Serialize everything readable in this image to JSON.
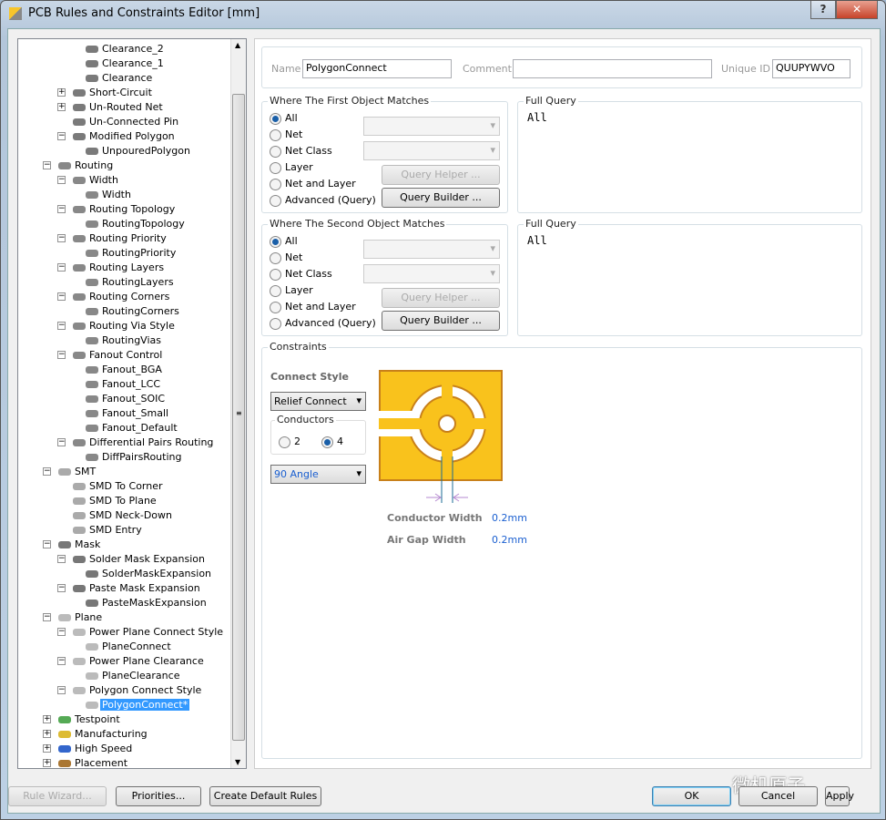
{
  "window": {
    "title": "PCB Rules and Constraints Editor [mm]",
    "help": "?",
    "close": "✕"
  },
  "tree": [
    [
      "Clearance_2",
      3,
      "",
      "rule"
    ],
    [
      "Clearance_1",
      3,
      "",
      "rule"
    ],
    [
      "Clearance",
      3,
      "",
      "rule"
    ],
    [
      "Short-Circuit",
      2,
      "+",
      "rule"
    ],
    [
      "Un-Routed Net",
      2,
      "+",
      "rule"
    ],
    [
      "Un-Connected Pin",
      2,
      "",
      "rule"
    ],
    [
      "Modified Polygon",
      2,
      "-",
      "rule"
    ],
    [
      "UnpouredPolygon",
      3,
      "",
      "rule"
    ],
    [
      "Routing",
      1,
      "-",
      "route"
    ],
    [
      "Width",
      2,
      "-",
      "route"
    ],
    [
      "Width",
      3,
      "",
      "route"
    ],
    [
      "Routing Topology",
      2,
      "-",
      "route"
    ],
    [
      "RoutingTopology",
      3,
      "",
      "route"
    ],
    [
      "Routing Priority",
      2,
      "-",
      "route"
    ],
    [
      "RoutingPriority",
      3,
      "",
      "route"
    ],
    [
      "Routing Layers",
      2,
      "-",
      "route"
    ],
    [
      "RoutingLayers",
      3,
      "",
      "route"
    ],
    [
      "Routing Corners",
      2,
      "-",
      "route"
    ],
    [
      "RoutingCorners",
      3,
      "",
      "route"
    ],
    [
      "Routing Via Style",
      2,
      "-",
      "route"
    ],
    [
      "RoutingVias",
      3,
      "",
      "route"
    ],
    [
      "Fanout Control",
      2,
      "-",
      "route"
    ],
    [
      "Fanout_BGA",
      3,
      "",
      "route"
    ],
    [
      "Fanout_LCC",
      3,
      "",
      "route"
    ],
    [
      "Fanout_SOIC",
      3,
      "",
      "route"
    ],
    [
      "Fanout_Small",
      3,
      "",
      "route"
    ],
    [
      "Fanout_Default",
      3,
      "",
      "route"
    ],
    [
      "Differential Pairs Routing",
      2,
      "-",
      "route"
    ],
    [
      "DiffPairsRouting",
      3,
      "",
      "route"
    ],
    [
      "SMT",
      1,
      "-",
      "smt"
    ],
    [
      "SMD To Corner",
      2,
      "",
      "smt"
    ],
    [
      "SMD To Plane",
      2,
      "",
      "smt"
    ],
    [
      "SMD Neck-Down",
      2,
      "",
      "smt"
    ],
    [
      "SMD Entry",
      2,
      "",
      "smt"
    ],
    [
      "Mask",
      1,
      "-",
      "mask"
    ],
    [
      "Solder Mask Expansion",
      2,
      "-",
      "mask"
    ],
    [
      "SolderMaskExpansion",
      3,
      "",
      "mask"
    ],
    [
      "Paste Mask Expansion",
      2,
      "-",
      "mask"
    ],
    [
      "PasteMaskExpansion",
      3,
      "",
      "mask"
    ],
    [
      "Plane",
      1,
      "-",
      "plane"
    ],
    [
      "Power Plane Connect Style",
      2,
      "-",
      "plane"
    ],
    [
      "PlaneConnect",
      3,
      "",
      "plane"
    ],
    [
      "Power Plane Clearance",
      2,
      "-",
      "plane"
    ],
    [
      "PlaneClearance",
      3,
      "",
      "plane"
    ],
    [
      "Polygon Connect Style",
      2,
      "-",
      "plane"
    ],
    [
      "PolygonConnect*",
      3,
      "",
      "plane"
    ],
    [
      "Testpoint",
      1,
      "+",
      "test"
    ],
    [
      "Manufacturing",
      1,
      "+",
      "mfg"
    ],
    [
      "High Speed",
      1,
      "+",
      "hs"
    ],
    [
      "Placement",
      1,
      "+",
      "place"
    ]
  ],
  "selected_index": 45,
  "rule": {
    "name_label": "Name",
    "name": "PolygonConnect",
    "comment_label": "Comment",
    "comment": "",
    "uid_label": "Unique ID",
    "uid": "QUUPYWVO"
  },
  "first": {
    "title": "Where The First Object Matches",
    "options": [
      "All",
      "Net",
      "Net Class",
      "Layer",
      "Net and Layer",
      "Advanced (Query)"
    ],
    "selected": "All",
    "query_helper": "Query Helper ...",
    "query_builder": "Query Builder ...",
    "full_query_label": "Full Query",
    "full_query": "All"
  },
  "second": {
    "title": "Where The Second Object Matches",
    "options": [
      "All",
      "Net",
      "Net Class",
      "Layer",
      "Net and Layer",
      "Advanced (Query)"
    ],
    "selected": "All",
    "query_helper": "Query Helper ...",
    "query_builder": "Query Builder ...",
    "full_query_label": "Full Query",
    "full_query": "All"
  },
  "constraints": {
    "title": "Constraints",
    "connect_style_label": "Connect Style",
    "connect_style": "Relief Connect",
    "conductors_label": "Conductors",
    "conductor_options": [
      "2",
      "4"
    ],
    "conductors": "4",
    "angle": "90 Angle",
    "conductor_width_label": "Conductor Width",
    "conductor_width": "0.2mm",
    "air_gap_label": "Air Gap Width",
    "air_gap": "0.2mm",
    "pad_color": "#f9c21c"
  },
  "footer": {
    "rule_wizard": "Rule Wizard...",
    "priorities": "Priorities...",
    "create_default": "Create Default Rules",
    "ok": "OK",
    "cancel": "Cancel",
    "apply": "Apply",
    "watermark": "微机原子"
  }
}
